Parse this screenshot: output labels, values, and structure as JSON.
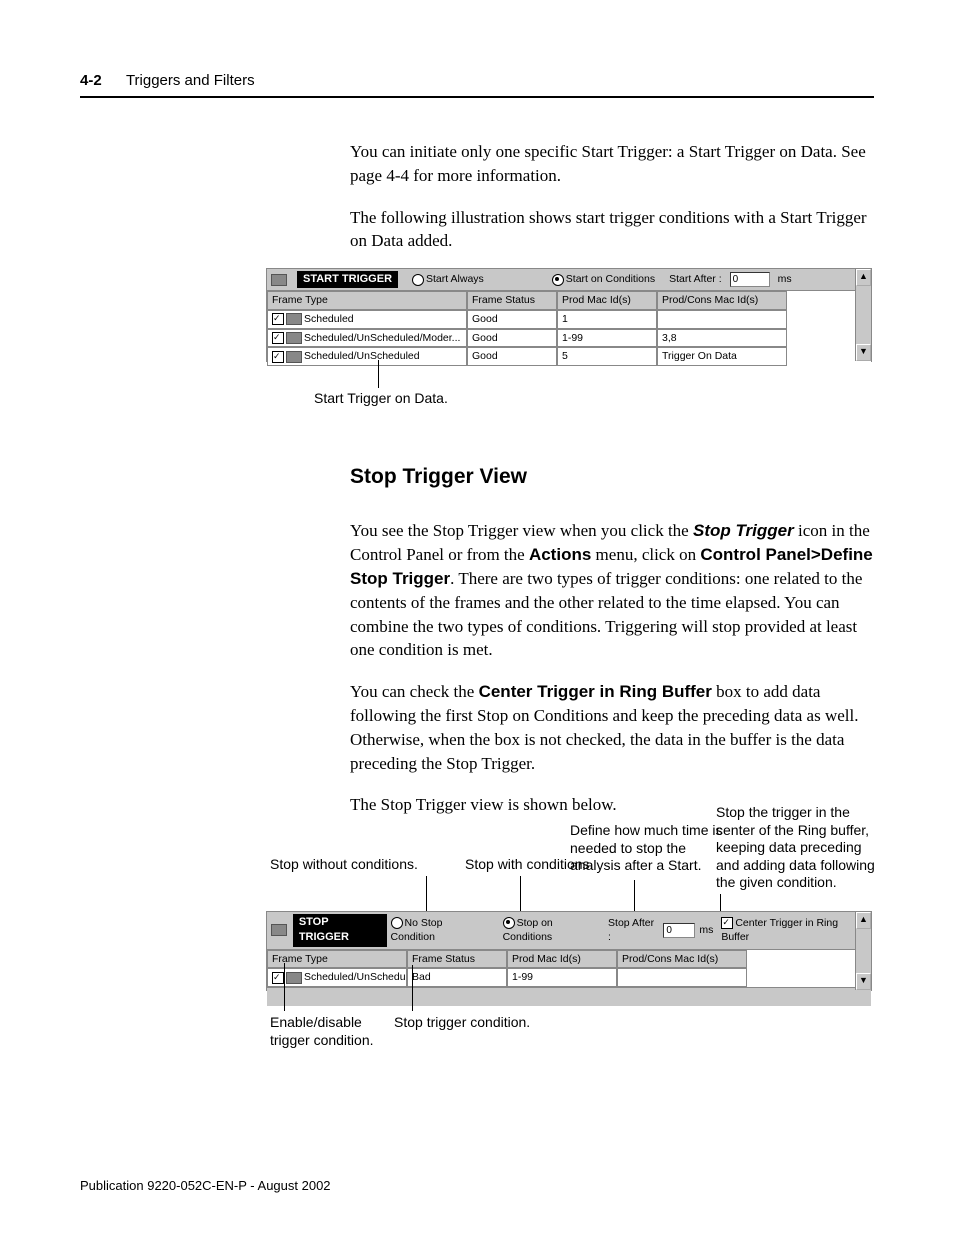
{
  "header": {
    "page_no": "4-2",
    "chapter": "Triggers and Filters"
  },
  "intro": {
    "p1": "You can initiate only one specific Start Trigger: a Start Trigger on Data. See page 4-4 for more information.",
    "p2": "The following illustration shows start trigger conditions with a Start Trigger on Data added."
  },
  "start_shot": {
    "title": "START TRIGGER",
    "opt_always": "Start Always",
    "opt_cond": "Start on Conditions",
    "start_after_lbl": "Start After :",
    "start_after_val": "0",
    "unit": "ms",
    "cols": {
      "c1": "Frame Type",
      "c2": "Frame Status",
      "c3": "Prod Mac Id(s)",
      "c4": "Prod/Cons Mac Id(s)"
    },
    "rows": [
      {
        "t": "Scheduled",
        "s": "Good",
        "p": "1",
        "pc": ""
      },
      {
        "t": "Scheduled/UnScheduled/Moder...",
        "s": "Good",
        "p": "1-99",
        "pc": "3,8"
      },
      {
        "t": "Scheduled/UnScheduled",
        "s": "Good",
        "p": "5",
        "pc": "Trigger On Data"
      }
    ]
  },
  "start_callout": "Start Trigger on Data.",
  "section_title": "Stop Trigger View",
  "stop_text": {
    "p1a": "You see the Stop Trigger view when you click the ",
    "p1b_bold": "Stop Trigger",
    "p1c": " icon in the Control Panel or from the ",
    "p1d_bold": "Actions",
    "p1e": " menu, click on ",
    "p1f_bold": "Control Panel>Define Stop Trigger",
    "p1g": ". There are two types of trigger conditions: one related to the contents of the frames and the other related to the time elapsed. You can combine the two types of conditions. Triggering will stop provided at least one condition is met.",
    "p2a": "You can check the ",
    "p2b_bold": "Center Trigger in Ring Buffer",
    "p2c": " box to add data following the first Stop on Conditions and keep the preceding data as well. Otherwise, when the box is not checked, the data in the buffer is the data preceding the Stop Trigger.",
    "p3": "The Stop Trigger view is shown below."
  },
  "stop_callouts": {
    "c1": "Stop without conditions.",
    "c2": "Stop with conditions.",
    "c3": "Define how much time is needed to stop the analysis after a Start.",
    "c4": "Stop the trigger in the center of the Ring buffer, keeping data preceding and adding data following the given condition.",
    "c5": "Enable/disable trigger condition.",
    "c6": "Stop trigger condition."
  },
  "stop_shot": {
    "title": "STOP TRIGGER",
    "opt_none": "No Stop Condition",
    "opt_cond": "Stop on Conditions",
    "stop_after_lbl": "Stop After :",
    "stop_after_val": "0",
    "unit": "ms",
    "center_lbl": "Center Trigger in Ring Buffer",
    "cols": {
      "c1": "Frame Type",
      "c2": "Frame Status",
      "c3": "Prod Mac Id(s)",
      "c4": "Prod/Cons Mac Id(s)"
    },
    "rows": [
      {
        "t": "Scheduled/UnScheduled/Moder...",
        "s": "Bad",
        "p": "1-99",
        "pc": ""
      }
    ]
  },
  "footer": "Publication 9220-052C-EN-P - August 2002"
}
